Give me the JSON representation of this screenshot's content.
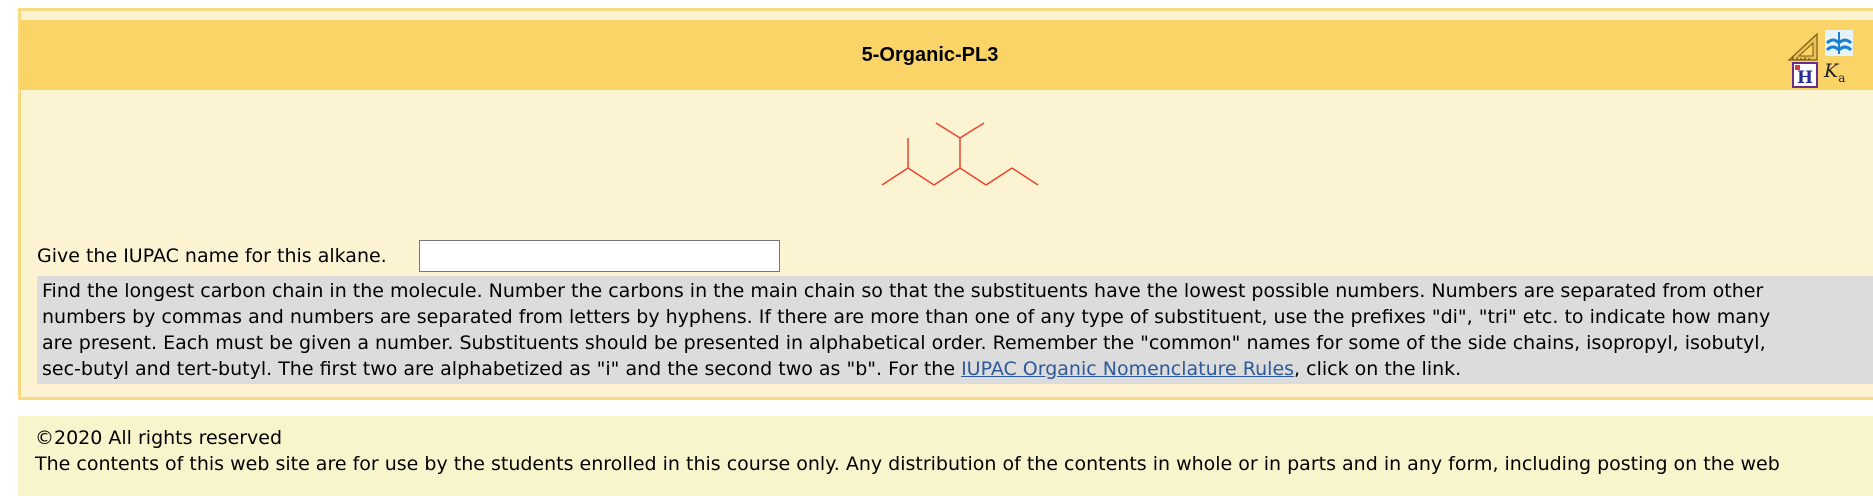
{
  "header": {
    "title": "5-Organic-PL3",
    "icons": [
      "ruler-triangle-icon",
      "book-icon",
      "periodic-table-icon",
      "ka-icon"
    ],
    "ka_label": "K",
    "ka_sub": "a"
  },
  "question": {
    "prompt": "Give the IUPAC name for this alkane.",
    "answer_value": "",
    "answer_placeholder": ""
  },
  "hint": {
    "lines": [
      "Find the longest carbon chain in the molecule. Number the carbons in the main chain so that the substituents have the lowest possible numbers. Numbers are separated from other",
      "numbers by commas and numbers are separated from letters by hyphens. If there are more than one of any type of substituent, use the prefixes \"di\", \"tri\" etc. to indicate how many",
      "are present. Each must be given a number. Substituents should be presented in alphabetical order. Remember the \"common\" names for some of the side chains, isopropyl, isobutyl,"
    ],
    "last_line_before_link": "sec-butyl and tert-butyl. The first two are alphabetized as \"i\" and the second two as \"b\". For the ",
    "link_text": "IUPAC Organic Nomenclature Rules",
    "last_line_after_link": ", click on the link."
  },
  "footer": {
    "copyright": "©2020 All rights reserved",
    "notice": "The contents of this web site are for use by the students enrolled in this course only. Any distribution of the contents in whole or in parts and in any form, including posting on the web"
  },
  "colors": {
    "molecule_bond": "#e8452e",
    "header_bg": "#fbd467",
    "panel_bg": "#fcf3d3",
    "hint_bg": "#dcdcdc",
    "footer_bg": "#f8f4cc",
    "link": "#2d5a9b"
  }
}
